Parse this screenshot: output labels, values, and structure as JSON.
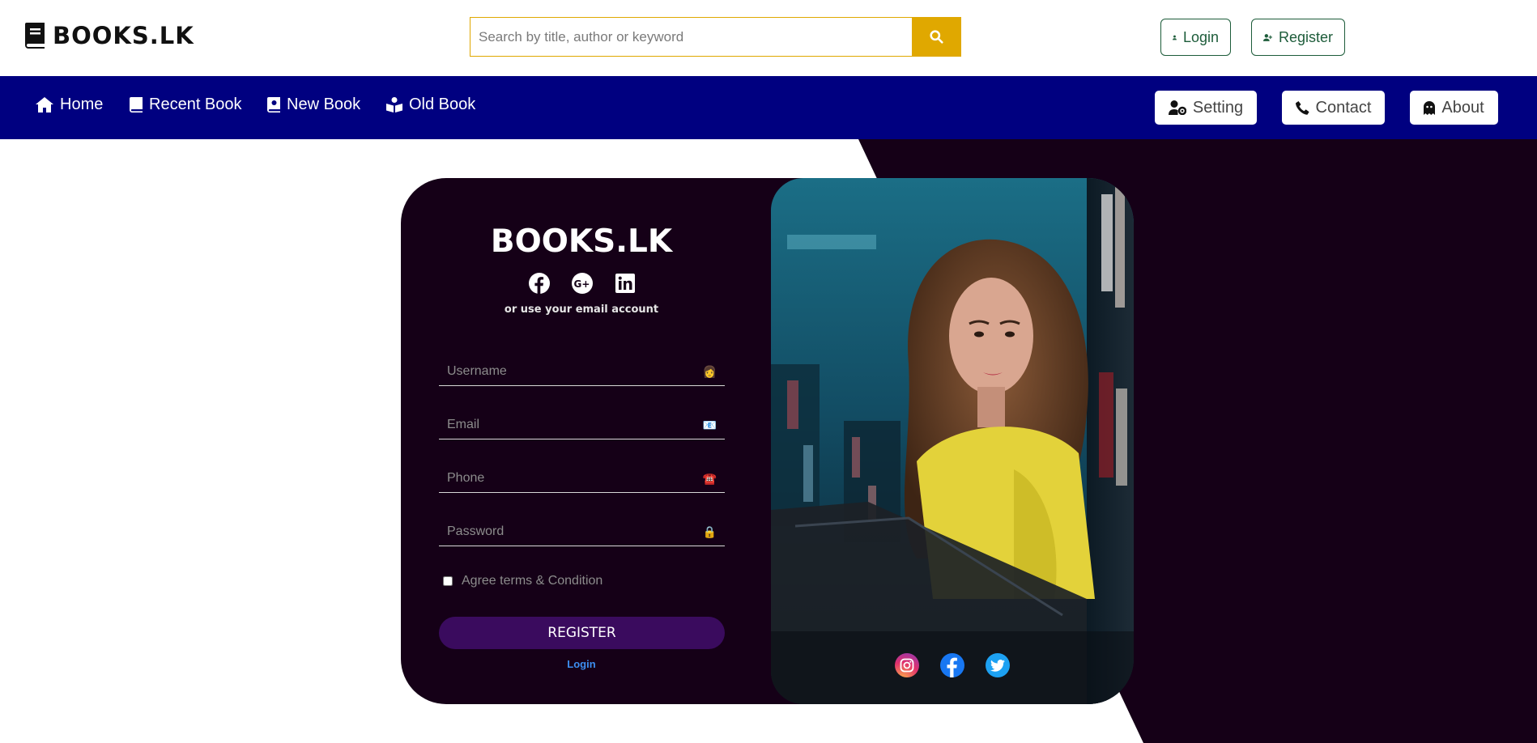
{
  "header": {
    "logo_text": "BOOKS.LK",
    "search_placeholder": "Search by title, author or keyword",
    "login_label": "Login",
    "register_label": "Register"
  },
  "nav": {
    "items": [
      {
        "label": "Home",
        "icon": "home-icon"
      },
      {
        "label": "Recent Book",
        "icon": "book-icon"
      },
      {
        "label": "New Book",
        "icon": "book-bookmark-icon"
      },
      {
        "label": "Old Book",
        "icon": "book-reader-icon"
      }
    ],
    "buttons": [
      {
        "label": "Setting",
        "icon": "user-gear-icon"
      },
      {
        "label": "Contact",
        "icon": "phone-icon"
      },
      {
        "label": "About",
        "icon": "ghost-icon"
      }
    ]
  },
  "form": {
    "brand": "BOOKS.LK",
    "social_icons": [
      "facebook-icon",
      "google-plus-icon",
      "linkedin-icon"
    ],
    "email_note": "or use your email account",
    "username_placeholder": "Username",
    "email_placeholder": "Email",
    "phone_placeholder": "Phone",
    "password_placeholder": "Password",
    "agree_label": "Agree terms & Condition",
    "agree_checked": false,
    "register_button": "REGISTER",
    "login_link": "Login"
  },
  "photo": {
    "social_icons": [
      "instagram-icon",
      "facebook-icon",
      "twitter-icon"
    ]
  },
  "colors": {
    "accent_search": "#e0a800",
    "navbar": "#000080",
    "card_bg": "#150017",
    "register_button": "#3a0b5e",
    "link": "#3d8ef0",
    "auth_button": "#1d5c3a"
  }
}
